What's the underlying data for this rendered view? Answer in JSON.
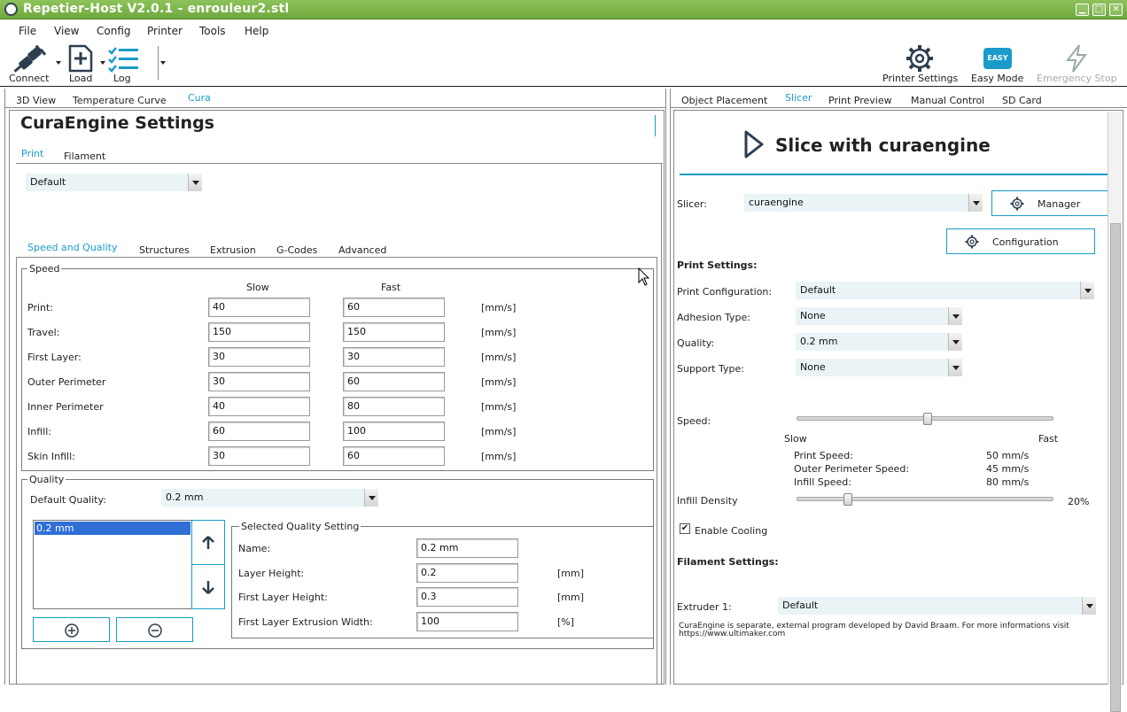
{
  "window": {
    "title": "Repetier-Host V2.0.1 - enrouleur2.stl"
  },
  "menu": [
    "File",
    "View",
    "Config",
    "Printer",
    "Tools",
    "Help"
  ],
  "toolbar": {
    "connect": "Connect",
    "load": "Load",
    "log": "Log",
    "printer_settings": "Printer Settings",
    "easy_mode": "Easy Mode",
    "easy_badge": "EASY",
    "emergency_stop": "Emergency Stop"
  },
  "left_tabs": [
    "3D View",
    "Temperature Curve",
    "Cura"
  ],
  "right_tabs": [
    "Object Placement",
    "Slicer",
    "Print Preview",
    "Manual Control",
    "SD Card"
  ],
  "cura": {
    "title": "CuraEngine Settings",
    "subtabs": [
      "Print",
      "Filament"
    ],
    "profile": "Default",
    "section_tabs": [
      "Speed and Quality",
      "Structures",
      "Extrusion",
      "G-Codes",
      "Advanced"
    ],
    "speed": {
      "group": "Speed",
      "col_slow": "Slow",
      "col_fast": "Fast",
      "unit": "[mm/s]",
      "rows": [
        {
          "label": "Print:",
          "slow": "40",
          "fast": "60"
        },
        {
          "label": "Travel:",
          "slow": "150",
          "fast": "150"
        },
        {
          "label": "First Layer:",
          "slow": "30",
          "fast": "30"
        },
        {
          "label": "Outer Perimeter",
          "slow": "30",
          "fast": "60"
        },
        {
          "label": "Inner Perimeter",
          "slow": "40",
          "fast": "80"
        },
        {
          "label": "Infill:",
          "slow": "60",
          "fast": "100"
        },
        {
          "label": "Skin Infill:",
          "slow": "30",
          "fast": "60"
        }
      ]
    },
    "quality": {
      "group": "Quality",
      "default_label": "Default Quality:",
      "default_value": "0.2 mm",
      "list": [
        "0.2 mm"
      ],
      "selected_group": "Selected Quality Setting",
      "fields": [
        {
          "label": "Name:",
          "value": "0.2 mm",
          "unit": ""
        },
        {
          "label": "Layer Height:",
          "value": "0.2",
          "unit": "[mm]"
        },
        {
          "label": "First Layer Height:",
          "value": "0.3",
          "unit": "[mm]"
        },
        {
          "label": "First Layer Extrusion Width:",
          "value": "100",
          "unit": "[%]"
        }
      ]
    }
  },
  "slicer": {
    "slice_button": "Slice with curaengine",
    "slicer_label": "Slicer:",
    "slicer_value": "curaengine",
    "manager": "Manager",
    "configuration": "Configuration",
    "print_settings": "Print Settings:",
    "settings": [
      {
        "label": "Print Configuration:",
        "value": "Default"
      },
      {
        "label": "Adhesion Type:",
        "value": "None"
      },
      {
        "label": "Quality:",
        "value": "0.2 mm"
      },
      {
        "label": "Support Type:",
        "value": "None"
      }
    ],
    "speed_label": "Speed:",
    "slow": "Slow",
    "fast": "Fast",
    "speed_level": 0.51,
    "speeds": [
      {
        "label": "Print Speed:",
        "value": "50 mm/s"
      },
      {
        "label": "Outer Perimeter Speed:",
        "value": "45 mm/s"
      },
      {
        "label": "Infill Speed:",
        "value": "80 mm/s"
      }
    ],
    "infill_label": "Infill Density",
    "infill_value": "20%",
    "infill_level": 0.2,
    "cooling_label": "Enable Cooling",
    "cooling_checked": true,
    "filament_settings": "Filament Settings:",
    "extruder_label": "Extruder 1:",
    "extruder_value": "Default",
    "note": "CuraEngine is separate, external program developed by David Braam. For more informations visit https://www.ultimaker.com"
  },
  "colors": {
    "accent": "#1a9bc9",
    "titlebar": "#7cb84a",
    "easy": "#1a9bc9"
  }
}
